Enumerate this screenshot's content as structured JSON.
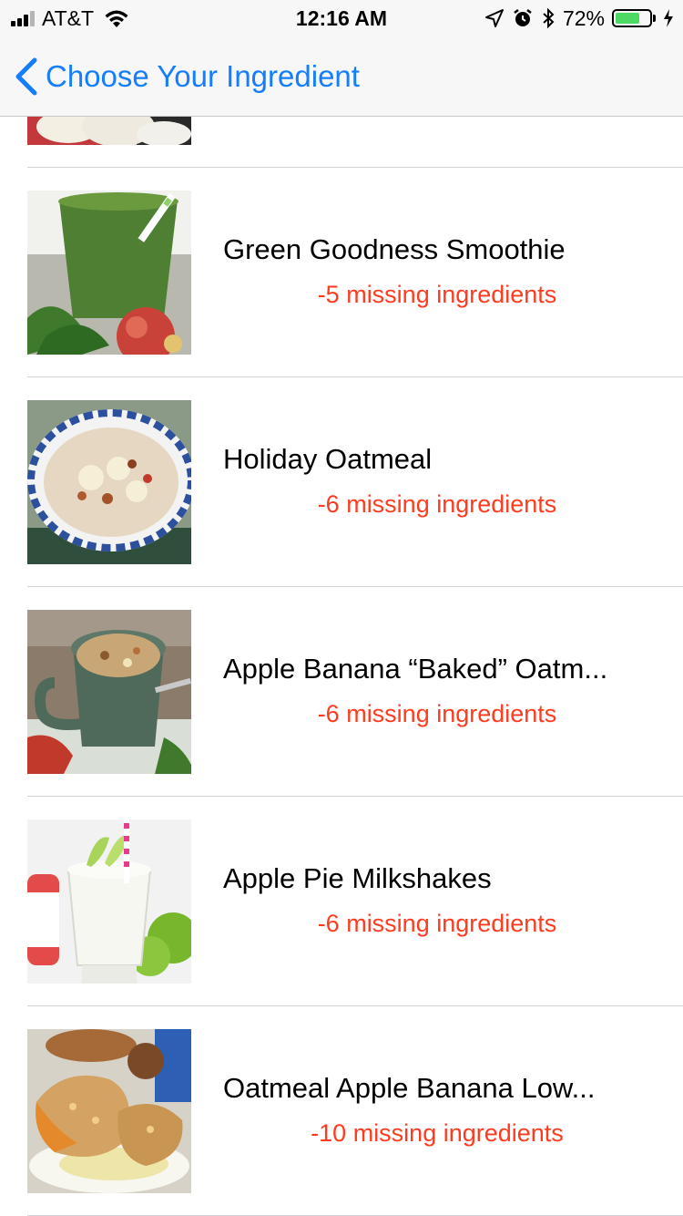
{
  "status_bar": {
    "carrier": "AT&T",
    "time": "12:16 AM",
    "battery_percent": "72%",
    "battery_level": 0.72,
    "signal_bars_filled": 3,
    "signal_bars_total": 4,
    "icons": [
      "signal-icon",
      "wifi-icon",
      "location-arrow-icon",
      "alarm-icon",
      "bluetooth-icon",
      "battery-icon",
      "charging-bolt-icon"
    ]
  },
  "nav": {
    "back_title": "Choose Your Ingredient",
    "accent_color": "#157efb"
  },
  "colors": {
    "missing_text": "#ff3b1f"
  },
  "recipes": [
    {
      "title": "",
      "missing": ""
    },
    {
      "title": "Green Goodness Smoothie",
      "missing": "-5 missing ingredients"
    },
    {
      "title": "Holiday Oatmeal",
      "missing": "-6 missing ingredients"
    },
    {
      "title": "Apple Banana “Baked” Oatm...",
      "missing": "-6 missing ingredients"
    },
    {
      "title": "Apple Pie Milkshakes",
      "missing": "-6 missing ingredients"
    },
    {
      "title": "Oatmeal Apple Banana Low...",
      "missing": "-10 missing ingredients"
    }
  ]
}
